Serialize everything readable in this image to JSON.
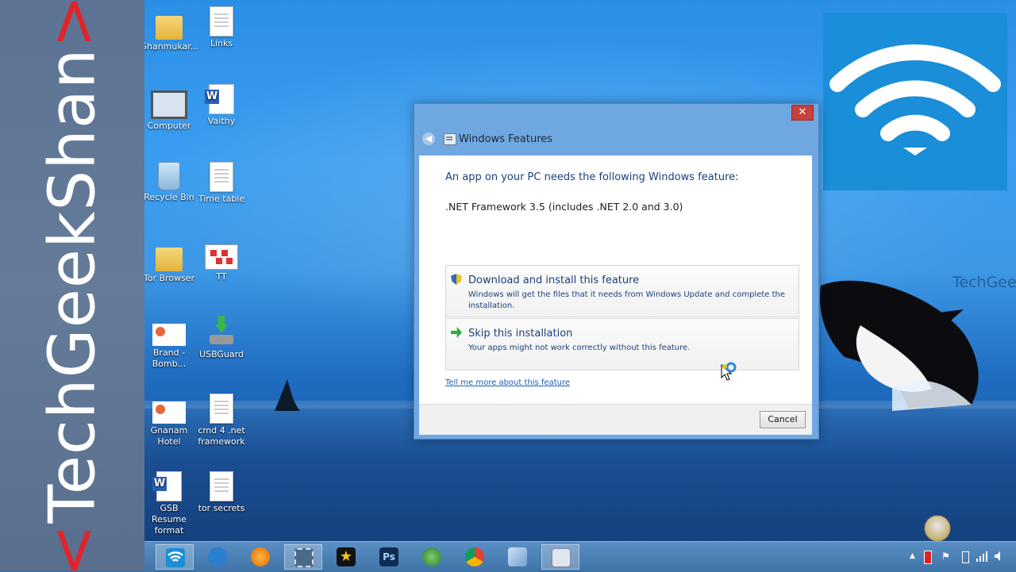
{
  "banner": {
    "left_bracket": "<",
    "name": "TechGeekShan",
    "right_bracket": ">"
  },
  "desktop": {
    "icons": [
      {
        "label": "Shanmukar..."
      },
      {
        "label": "Links"
      },
      {
        "label": "Computer"
      },
      {
        "label": "Vaithy"
      },
      {
        "label": "Recycle Bin"
      },
      {
        "label": "Time table"
      },
      {
        "label": "Tor Browser"
      },
      {
        "label": "TT"
      },
      {
        "label": "Brand - Bomb..."
      },
      {
        "label": "USBGuard"
      },
      {
        "label": "Gnanam Hotel"
      },
      {
        "label": "cmd 4 .net framework"
      },
      {
        "label": "GSB Resume format"
      },
      {
        "label": "tor secrets"
      }
    ],
    "watermark": "TechGeek"
  },
  "dialog": {
    "title": "Windows Features",
    "close_label": "✕",
    "prompt": "An app on your PC needs the following Windows feature:",
    "feature": ".NET Framework 3.5 (includes .NET 2.0 and 3.0)",
    "option_download": {
      "title": "Download and install this feature",
      "description": "Windows will get the files that it needs from Windows Update and complete the installation."
    },
    "option_skip": {
      "title": "Skip this installation",
      "description": "Your apps might not work correctly without this feature."
    },
    "link": "Tell me more about this feature",
    "cancel_label": "Cancel"
  },
  "taskbar": {
    "items": [
      {
        "icon": "wifi-icon",
        "label": ""
      },
      {
        "icon": "media-player-icon",
        "label": ""
      },
      {
        "icon": "vlc-icon",
        "label": ""
      },
      {
        "icon": "film-icon",
        "label": ""
      },
      {
        "icon": "star-movie-icon",
        "label": ""
      },
      {
        "icon": "photoshop-icon",
        "label": "Ps"
      },
      {
        "icon": "globe-icon",
        "label": ""
      },
      {
        "icon": "chrome-icon",
        "label": ""
      },
      {
        "icon": "control-panel-icon",
        "label": ""
      },
      {
        "icon": "windows-features-icon",
        "label": ""
      }
    ],
    "tray": {
      "up_arrow": "▲",
      "flag": "⚑"
    }
  },
  "colors": {
    "accent": "#1a8ed8",
    "close": "#c7403a",
    "link": "#1a5fb4"
  }
}
